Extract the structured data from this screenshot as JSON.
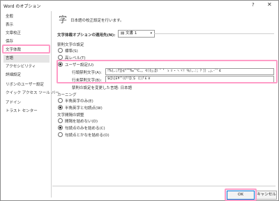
{
  "window": {
    "title": "Word のオプション",
    "help_icon": "?",
    "close_icon": "✕"
  },
  "sidebar": {
    "items": [
      {
        "label": "全般"
      },
      {
        "label": "表示"
      },
      {
        "label": "文章校正"
      },
      {
        "label": "保存"
      },
      {
        "label": "文字体裁"
      },
      {
        "label": "言語"
      },
      {
        "label": "アクセシビリティ"
      },
      {
        "label": "詳細設定"
      },
      {
        "label": "リボンのユーザー設定"
      },
      {
        "label": "クイック アクセス ツール バー"
      },
      {
        "label": "アドイン"
      },
      {
        "label": "トラスト センター"
      }
    ],
    "selected_index": 4
  },
  "main": {
    "description": "日本語の校正設定を行います。",
    "scope_label": "文字体裁オプションの適用先(N):",
    "scope_value": "文書 1",
    "kinsoku_section": "禁則文字の設定",
    "kinsoku_options": [
      "標準(S)",
      "高レベル(T)",
      "ユーザー設定(U)"
    ],
    "kinsoku_selected": 2,
    "line_start_label": "行頭禁則文字(A):",
    "line_start_value": "!%),.:;?]}¢°’”‰′″℃、。々〉》」』】〕゛゜ゝゞ・ヽヾ！％），．：；？］｝｡｣､･ﾞﾟ￠",
    "line_end_label": "行末禁則文字(B):",
    "line_end_value": "$([\\{£¥‘“〈《「『【〔＄（［｛｢￡￥",
    "note": "禁則の設定を変更した言語: 日本語",
    "kerning_section": "カーニング",
    "kerning_options": [
      "半角英字のみ(E)",
      "半角英字と句読点(W)"
    ],
    "kerning_selected": 1,
    "spacing_section": "文字間隔の調整",
    "spacing_options": [
      "間隔を詰めない(D)",
      "句読点のみを詰める(C)",
      "句読点とかなを詰める(O)"
    ],
    "spacing_selected": 1
  },
  "footer": {
    "ok_label": "OK",
    "cancel_label": "キャンセル"
  },
  "colors": {
    "highlight": "#ff9cc7",
    "selected_bg": "#e5e5e5"
  }
}
